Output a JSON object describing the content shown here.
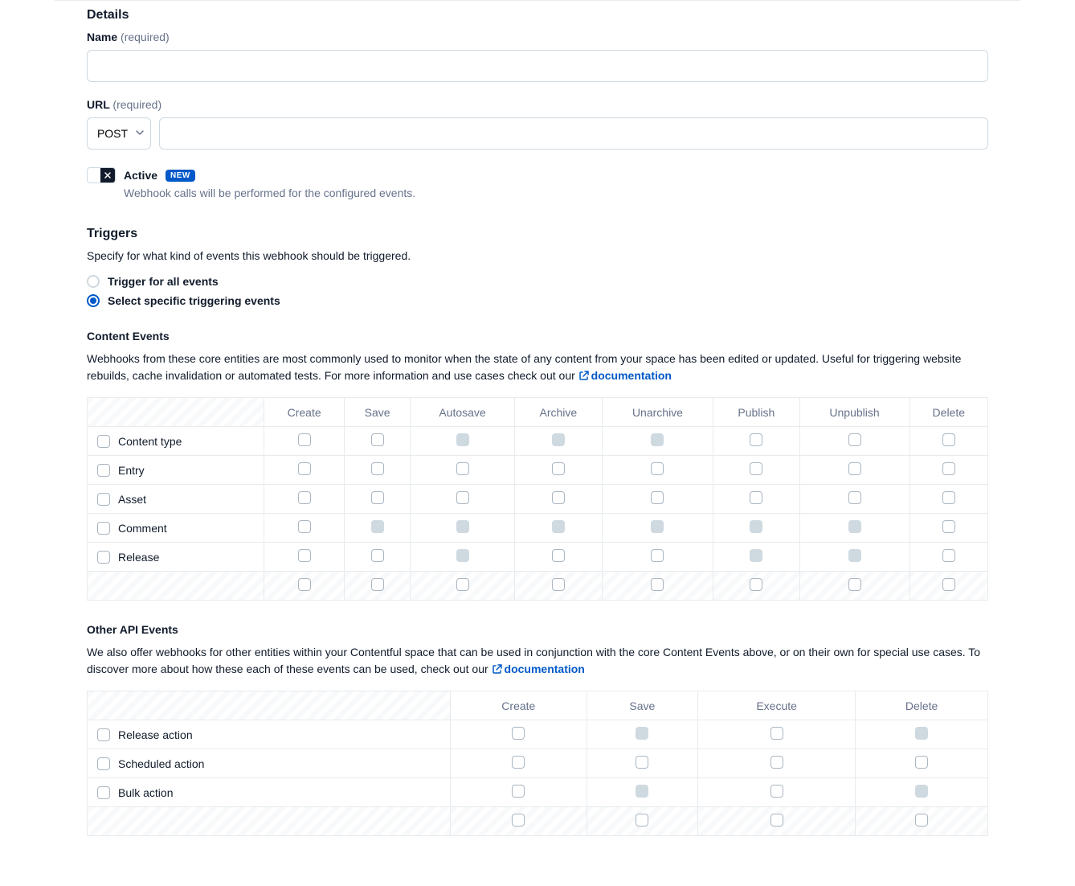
{
  "details": {
    "heading": "Details",
    "name_label": "Name",
    "required": "(required)",
    "name_value": "",
    "url_label": "URL",
    "method": "POST",
    "url_value": "",
    "active_label": "Active",
    "new_badge": "NEW",
    "active_help": "Webhook calls will be performed for the configured events."
  },
  "triggers": {
    "heading": "Triggers",
    "description": "Specify for what kind of events this webhook should be triggered.",
    "option_all": "Trigger for all events",
    "option_specific": "Select specific triggering events"
  },
  "content_events": {
    "heading": "Content Events",
    "description": "Webhooks from these core entities are most commonly used to monitor when the state of any content from your space has been edited or updated. Useful for triggering website rebuilds, cache invalidation or automated tests. For more information and use cases check out our ",
    "doc_link": "documentation",
    "columns": [
      "Create",
      "Save",
      "Autosave",
      "Archive",
      "Unarchive",
      "Publish",
      "Unpublish",
      "Delete"
    ],
    "rows": [
      {
        "label": "Content type",
        "disabled": [
          2,
          3,
          4
        ]
      },
      {
        "label": "Entry",
        "disabled": []
      },
      {
        "label": "Asset",
        "disabled": []
      },
      {
        "label": "Comment",
        "disabled": [
          1,
          2,
          3,
          4,
          5,
          6
        ]
      },
      {
        "label": "Release",
        "disabled": [
          2,
          5,
          6
        ]
      }
    ]
  },
  "api_events": {
    "heading": "Other API Events",
    "description": "We also offer webhooks for other entities within your Contentful space that can be used in conjunction with the core Content Events above, or on their own for special use cases. To discover more about how these each of these events can be used, check out our ",
    "doc_link": "documentation",
    "columns": [
      "Create",
      "Save",
      "Execute",
      "Delete"
    ],
    "rows": [
      {
        "label": "Release action",
        "disabled": [
          1,
          3
        ]
      },
      {
        "label": "Scheduled action",
        "disabled": []
      },
      {
        "label": "Bulk action",
        "disabled": [
          1,
          3
        ]
      }
    ]
  }
}
